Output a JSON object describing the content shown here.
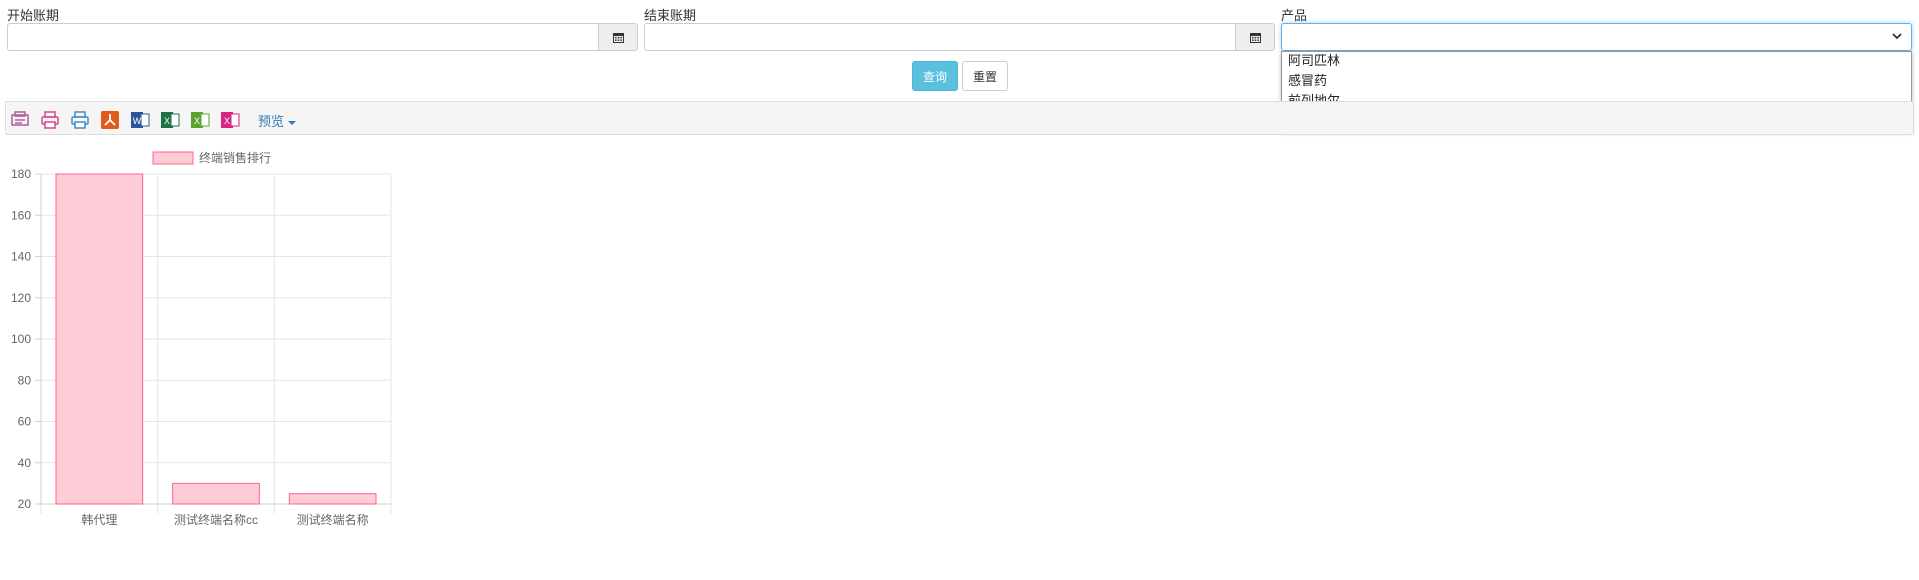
{
  "filters": {
    "start_label": "开始账期",
    "end_label": "结束账期",
    "product_label": "产品",
    "product_value": ""
  },
  "dropdown": {
    "options": [
      "阿司匹林",
      "感冒药",
      "前列地尔",
      ""
    ]
  },
  "buttons": {
    "query": "查询",
    "reset": "重置"
  },
  "toolbar": {
    "icons": [
      "print-preview-icon",
      "print-icon",
      "printer-icon",
      "pdf-icon",
      "word-icon",
      "excel-icon",
      "excel-xlsx-icon",
      "excel-xls-icon"
    ],
    "icon_colors": [
      "#b05b9c",
      "#d14b8f",
      "#3a8fc8",
      "#e05a1c",
      "#2b579a",
      "#1e7145",
      "#5ba32b",
      "#d6247f"
    ],
    "preview_label": "预览"
  },
  "chart_data": {
    "type": "bar",
    "legend": "终端销售排行",
    "categories": [
      "韩代理",
      "测试终端名称cc",
      "测试终端名称"
    ],
    "values": [
      180,
      30,
      25
    ],
    "ylim": [
      20,
      180
    ],
    "yticks": [
      20,
      40,
      60,
      80,
      100,
      120,
      140,
      160,
      180
    ],
    "grid": true,
    "bar_fill": "#ffcdd8",
    "bar_stroke": "#ff6384"
  }
}
